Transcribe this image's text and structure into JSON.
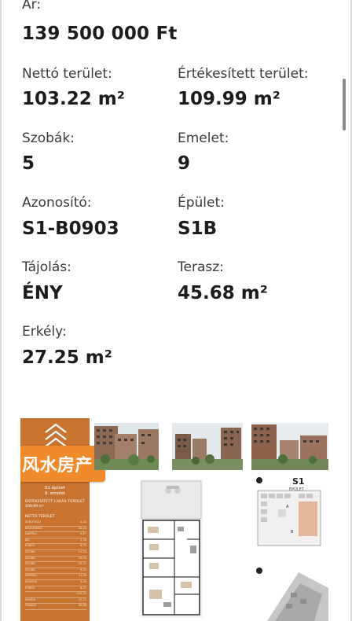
{
  "price": {
    "label": "Ár:",
    "value": "139 500 000 Ft"
  },
  "fields": [
    {
      "label": "Nettó terület:",
      "value": "103.22 m²"
    },
    {
      "label": "Értékesített terület:",
      "value": "109.99 m²"
    },
    {
      "label": "Szobák:",
      "value": "5"
    },
    {
      "label": "Emelet:",
      "value": "9"
    },
    {
      "label": "Azonosító:",
      "value": "S1-B0903"
    },
    {
      "label": "Épület:",
      "value": "S1B"
    },
    {
      "label": "Tájolás:",
      "value": "ÉNY"
    },
    {
      "label": "Terasz:",
      "value": "45.68 m²"
    },
    {
      "label": "Erkély:",
      "value": "27.25 m²"
    }
  ],
  "brochure": {
    "watermark": "风水房产",
    "panel_building": "S1 épület",
    "panel_floor": "9. emelet",
    "panel_area_title": "ÉRTÉKESÍTETT LAKÁS TERÜLET",
    "panel_area_value": "109,99 m²",
    "panel_net_title": "NETTÓ TERÜLET",
    "panel_rows": [
      {
        "name": "SZÉLFOGÓ",
        "value": "4,10"
      },
      {
        "name": "KÖZLEKEDŐ",
        "value": "10,04"
      },
      {
        "name": "NAPPALI",
        "value": "9,47"
      },
      {
        "name": "WC",
        "value": "1,78"
      },
      {
        "name": "FÜRDŐ",
        "value": "6,52"
      },
      {
        "name": "SZOBA",
        "value": "11,53"
      },
      {
        "name": "SZOBA",
        "value": "10,04"
      },
      {
        "name": "SZOBA",
        "value": "15,11"
      },
      {
        "name": "SZOBA",
        "value": "9,52"
      },
      {
        "name": "NAPPALI",
        "value": "21,09"
      },
      {
        "name": "KONYHA",
        "value": "3,04"
      },
      {
        "name": "FÜRDŐ",
        "value": "6,07"
      },
      {
        "name": "",
        "value": "103,22"
      },
      {
        "name": "ERKÉLY",
        "value": "27,25"
      },
      {
        "name": "TERASZ",
        "value": "45,68"
      }
    ],
    "key_title": "S1",
    "key_subtitle": "ÉPÜLET",
    "key_label_a": "A",
    "key_label_b": "B"
  }
}
